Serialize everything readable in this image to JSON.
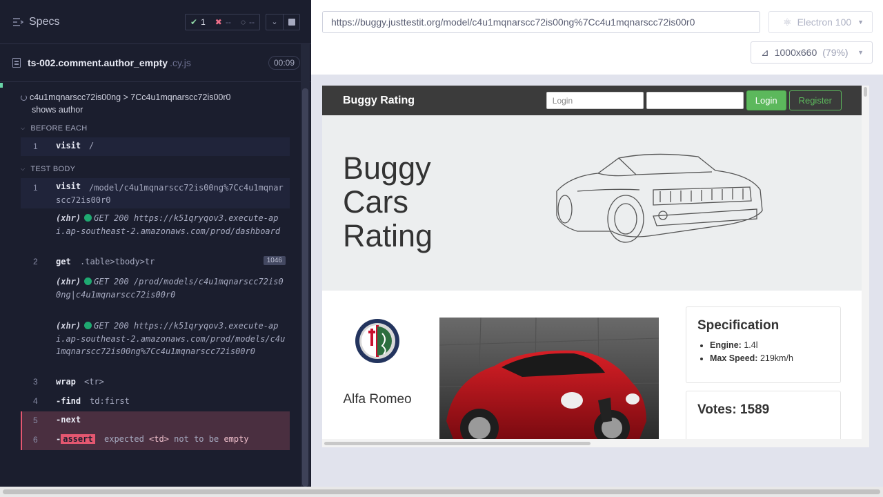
{
  "reporter": {
    "specs_label": "Specs",
    "stats": {
      "passed": "1",
      "failed": "--",
      "pending": "--"
    },
    "file": {
      "name": "ts-002.comment.author_empty",
      "ext": ".cy.js",
      "duration": "00:09"
    },
    "test_path": "c4u1mqnarscc72is00ng > 7Cc4u1mqnarscc72is00r0",
    "test_title": "shows author",
    "before_each_label": "BEFORE EACH",
    "test_body_label": "TEST BODY",
    "before_each_cmds": [
      {
        "num": "1",
        "name": "visit",
        "msg": "/"
      }
    ],
    "commands": [
      {
        "num": "1",
        "name": "visit",
        "msg": "/model/c4u1mqnarscc72is00ng%7Cc4u1mqnarscc72is00r0"
      },
      {
        "xhr": "(xhr)",
        "method": "GET 200",
        "url": "https://k51qryqov3.execute-api.ap-southeast-2.amazonaws.com/prod/dashboard"
      },
      {
        "num": "2",
        "name": "get",
        "msg": ".table>tbody>tr",
        "count": "1046"
      },
      {
        "xhr": "(xhr)",
        "method": "GET 200",
        "url": "/prod/models/c4u1mqnarscc72is00ng|c4u1mqnarscc72is00r0"
      },
      {
        "xhr": "(xhr)",
        "method": "GET 200",
        "url": "https://k51qryqov3.execute-api.ap-southeast-2.amazonaws.com/prod/models/c4u1mqnarscc72is00ng%7Cc4u1mqnarscc72is00r0"
      },
      {
        "num": "3",
        "name": "wrap",
        "msg": "<tr>"
      },
      {
        "num": "4",
        "name": "-find",
        "msg": "td:first"
      },
      {
        "num": "5",
        "name": "-next",
        "msg": ""
      },
      {
        "num": "6",
        "name": "-assert",
        "tag": "assert",
        "msg_parts": [
          "expected",
          "<td>",
          "not to be",
          "empty"
        ]
      }
    ]
  },
  "toolbar": {
    "url": "https://buggy.justtestit.org/model/c4u1mqnarscc72is00ng%7Cc4u1mqnarscc72is00r0",
    "browser": "Electron 100",
    "viewport": "1000x660",
    "zoom": "(79%)"
  },
  "aut": {
    "brand": "Buggy Rating",
    "login_placeholder": "Login",
    "password_placeholder": "",
    "login_button": "Login",
    "register_button": "Register",
    "hero_title_lines": [
      "Buggy",
      "Cars",
      "Rating"
    ],
    "make_name": "Alfa Romeo",
    "spec_title": "Specification",
    "spec_items": [
      {
        "label": "Engine:",
        "value": "1.4l"
      },
      {
        "label": "Max Speed:",
        "value": "219km/h"
      }
    ],
    "votes": "Votes: 1589"
  },
  "colors": {
    "pass": "#1fa971",
    "fail": "#e45770",
    "login_green": "#5cb85c",
    "reporter_bg": "#1b1e2e"
  }
}
